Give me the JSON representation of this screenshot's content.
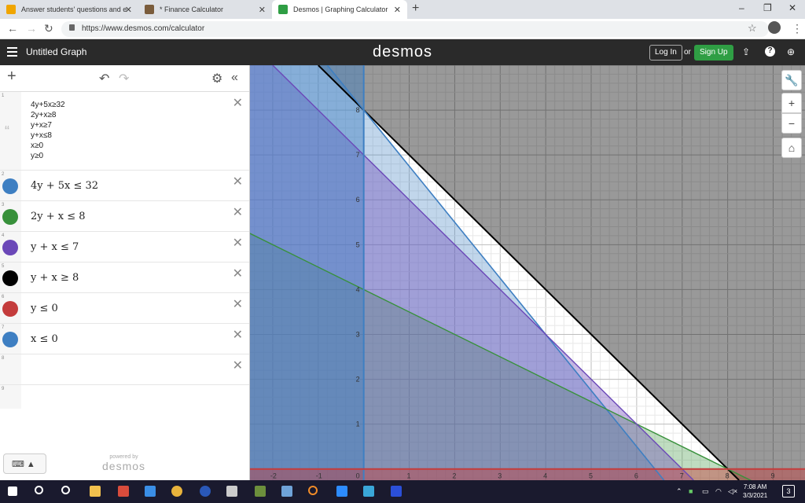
{
  "browser": {
    "tabs": [
      {
        "title": "Answer students' questions and e",
        "active": false
      },
      {
        "title": "* Finance Calculator",
        "active": false
      },
      {
        "title": "Desmos | Graphing Calculator",
        "active": true
      }
    ],
    "url": "https://www.desmos.com/calculator"
  },
  "header": {
    "graph_title": "Untitled Graph",
    "logo": "desmos",
    "login_label": "Log In",
    "or_label": "or",
    "signup_label": "Sign Up"
  },
  "notes": {
    "index": "1",
    "lines": [
      "4y+5x≥32",
      "2y+x≥8",
      "y+x≥7",
      "y+x≤8",
      "x≥0",
      "y≥0"
    ]
  },
  "expressions": [
    {
      "index": "2",
      "latex": "4y + 5x  ≤  32",
      "color": "#3e7fc2"
    },
    {
      "index": "3",
      "latex": "2y + x ≤ 8",
      "color": "#38913b"
    },
    {
      "index": "4",
      "latex": "y + x  ≤  7",
      "color": "#6b48b8"
    },
    {
      "index": "5",
      "latex": "y + x  ≥  8",
      "color": "#000000"
    },
    {
      "index": "6",
      "latex": "y  ≤  0",
      "color": "#c43c3c"
    },
    {
      "index": "7",
      "latex": "x  ≤  0",
      "color": "#3e7fc2"
    }
  ],
  "empty_rows": [
    "8",
    "9"
  ],
  "footer": {
    "powered_by": "powered by",
    "brand": "desmos"
  },
  "graph": {
    "xlim": [
      -2.5,
      9.7
    ],
    "ylim": [
      -0.25,
      9
    ],
    "x_ticks": [
      "-2",
      "-1",
      "0",
      "1",
      "2",
      "3",
      "4",
      "5",
      "6",
      "7",
      "8",
      "9"
    ],
    "y_ticks": [
      "1",
      "2",
      "3",
      "4",
      "5",
      "6",
      "7",
      "8"
    ]
  },
  "taskbar": {
    "time": "7:08 AM",
    "date": "3/3/2021",
    "notifications": "3"
  }
}
